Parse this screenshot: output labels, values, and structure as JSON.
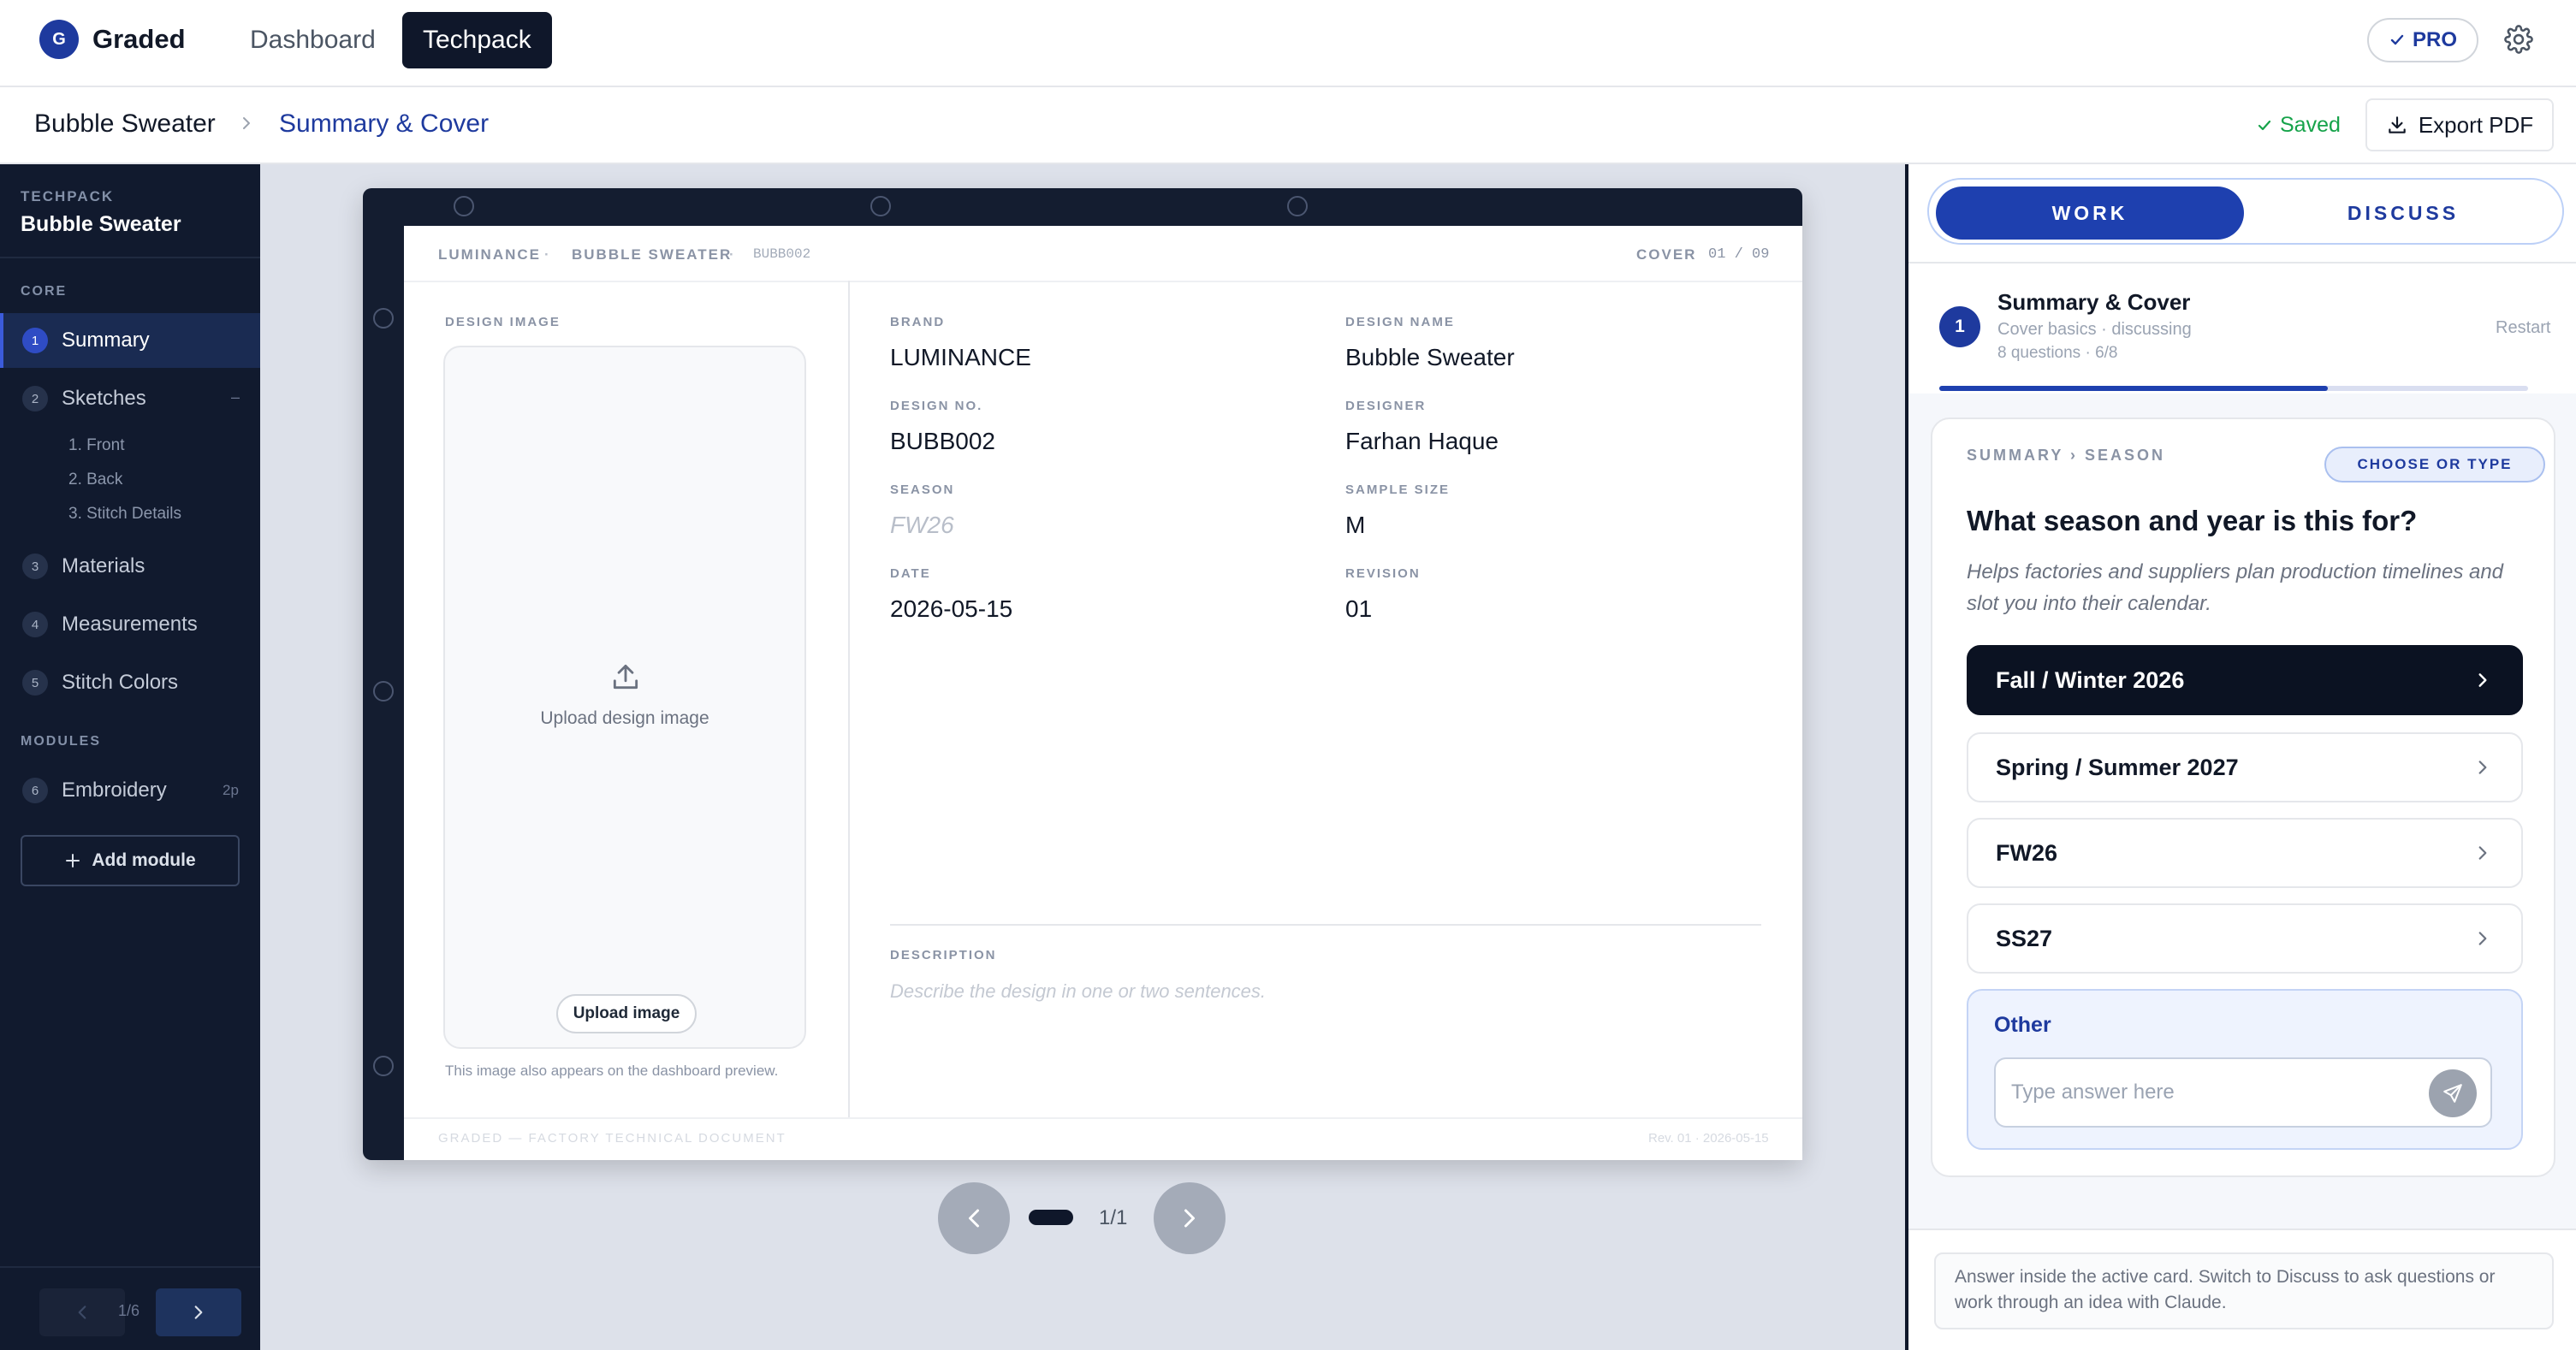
{
  "app": {
    "logo_letter": "G",
    "name": "Graded"
  },
  "nav": {
    "dashboard": "Dashboard",
    "techpack": "Techpack",
    "pro": "PRO"
  },
  "breadcrumb": {
    "project": "Bubble Sweater",
    "section": "Summary & Cover",
    "saved": "Saved",
    "export": "Export PDF"
  },
  "sidebar": {
    "caption": "TECHPACK",
    "project": "Bubble Sweater",
    "core_caption": "CORE",
    "items": [
      {
        "num": "1",
        "label": "Summary"
      },
      {
        "num": "2",
        "label": "Sketches",
        "extra": "–"
      },
      {
        "num": "3",
        "label": "Materials"
      },
      {
        "num": "4",
        "label": "Measurements"
      },
      {
        "num": "5",
        "label": "Stitch Colors"
      }
    ],
    "sketch_subs": [
      "1. Front",
      "2. Back",
      "3. Stitch Details"
    ],
    "modules_caption": "MODULES",
    "module": {
      "num": "6",
      "label": "Embroidery",
      "extra": "2p"
    },
    "add_module": "Add module",
    "page_count": "1/6"
  },
  "doc": {
    "header_left": [
      "LUMINANCE",
      "·",
      "BUBBLE SWEATER",
      "·",
      "BUBB002"
    ],
    "header_right": {
      "label": "COVER",
      "page": "01 / 09"
    },
    "design_image_cap": "DESIGN IMAGE",
    "upload_text": "Upload design image",
    "upload_btn": "Upload image",
    "image_note": "This image also appears on the dashboard preview.",
    "fields": [
      {
        "cap": "BRAND",
        "value": "LUMINANCE"
      },
      {
        "cap": "DESIGN NAME",
        "value": "Bubble Sweater"
      },
      {
        "cap": "DESIGN NO.",
        "value": "BUBB002"
      },
      {
        "cap": "DESIGNER",
        "value": "Farhan Haque"
      },
      {
        "cap": "SEASON",
        "value": "FW26"
      },
      {
        "cap": "SAMPLE SIZE",
        "value": "M"
      },
      {
        "cap": "DATE",
        "value": "2026-05-15"
      },
      {
        "cap": "REVISION",
        "value": "01"
      }
    ],
    "description_cap": "DESCRIPTION",
    "description_placeholder": "Describe the design in one or two sentences.",
    "footer_left": "GRADED — FACTORY TECHNICAL DOCUMENT",
    "footer_right": "Rev. 01 · 2026-05-15"
  },
  "canvas": {
    "page_count": "1/1"
  },
  "panel": {
    "tab_work": "WORK",
    "tab_discuss": "DISCUSS",
    "step": {
      "num": "1",
      "title": "Summary & Cover",
      "subtitle": "Cover basics · discussing",
      "meta": "8 questions · 6/8",
      "restart": "Restart",
      "progress": 0.66
    },
    "question": {
      "path": "SUMMARY › SEASON",
      "badge": "CHOOSE OR TYPE",
      "title": "What season and year is this for?",
      "help": "Helps factories and suppliers plan production timelines and slot you into their calendar.",
      "options": [
        "Fall / Winter 2026",
        "Spring / Summer 2027",
        "FW26",
        "SS27"
      ],
      "selected": 0,
      "other_label": "Other",
      "other_placeholder": "Type answer here"
    },
    "hint": "Answer inside the active card. Switch to Discuss to ask questions or work through an idea with Claude."
  },
  "colors": {
    "brand": "#1e3a9e",
    "accent": "#1e40af",
    "sidebar": "#111a2e",
    "saved": "#16a34a"
  }
}
